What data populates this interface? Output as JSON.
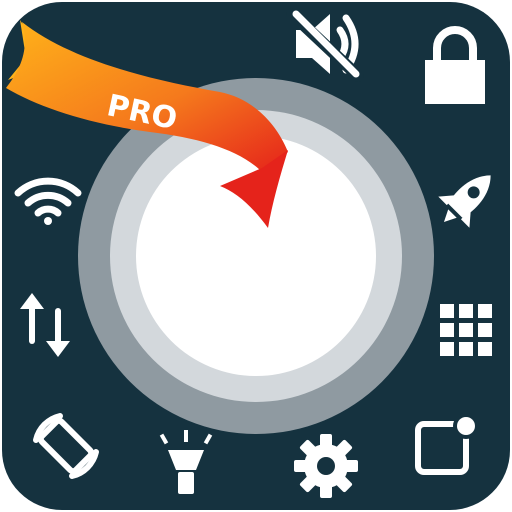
{
  "app": {
    "badge_text": "PRO",
    "colors": {
      "panel": "#15323f",
      "icon": "#ffffff",
      "ring_outer": "#8f9aa1",
      "ring_inner": "#d3d8dc",
      "center": "#ffffff",
      "banner_top": "#ffb31a",
      "banner_mid": "#f57a1c",
      "banner_end": "#e5231b",
      "banner_text": "#ffffff"
    }
  },
  "toggles": [
    {
      "name": "mute-toggle",
      "icon": "speaker-muted-icon"
    },
    {
      "name": "lock-toggle",
      "icon": "lock-icon"
    },
    {
      "name": "wifi-toggle",
      "icon": "wifi-icon"
    },
    {
      "name": "boost-toggle",
      "icon": "rocket-icon"
    },
    {
      "name": "mobile-data-toggle",
      "icon": "data-transfer-icon"
    },
    {
      "name": "app-grid-toggle",
      "icon": "grid-icon"
    },
    {
      "name": "auto-rotate-toggle",
      "icon": "screen-rotation-icon"
    },
    {
      "name": "flashlight-toggle",
      "icon": "flashlight-icon"
    },
    {
      "name": "settings-toggle",
      "icon": "gear-icon"
    },
    {
      "name": "notification-toggle",
      "icon": "notification-badge-icon"
    }
  ]
}
